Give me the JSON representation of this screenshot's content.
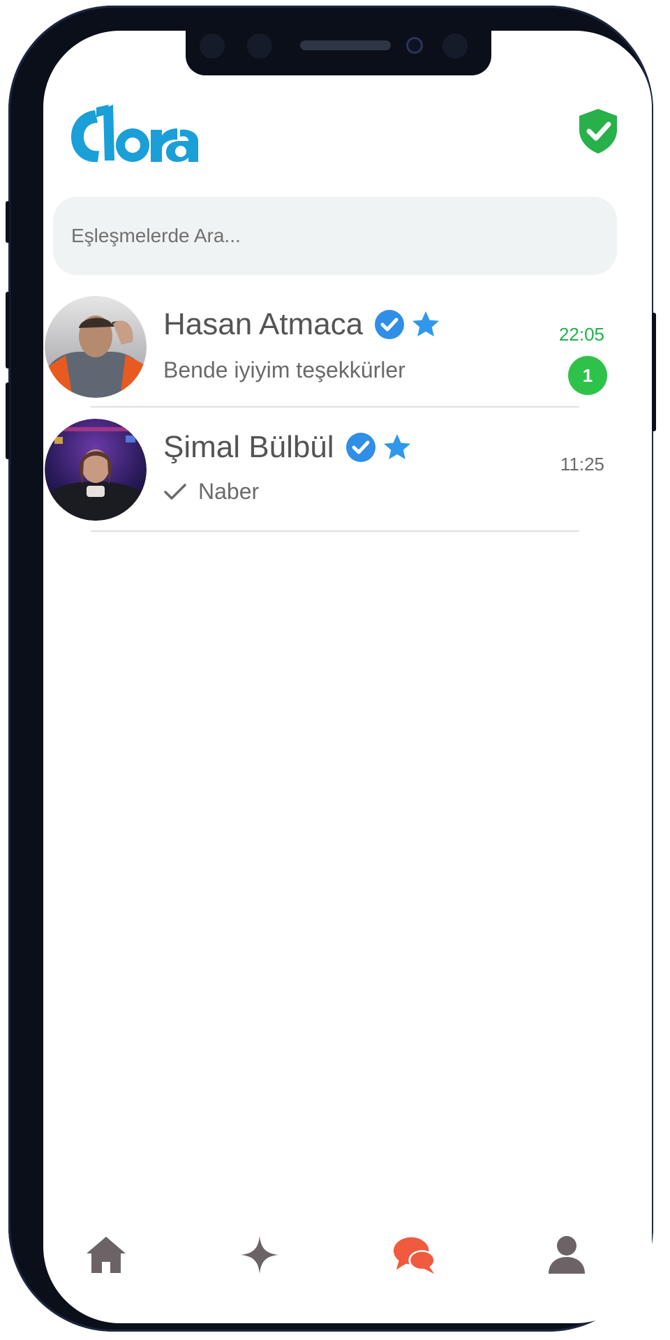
{
  "app": {
    "logo_text": "dora",
    "brand_color": "#1a9fd8",
    "shield_color": "#28b04a"
  },
  "search": {
    "placeholder": "Eşleşmelerde Ara..."
  },
  "conversations": [
    {
      "name": "Hasan Atmaca",
      "last_message": "Bende iyiyim teşekkürler",
      "time": "22:05",
      "unread_count": "1",
      "verified": true,
      "starred": true
    },
    {
      "name": "Şimal Bülbül",
      "last_message": "Naber",
      "time": "11:25",
      "sent_status": "check-icon",
      "verified": true,
      "starred": true
    }
  ],
  "tabbar": {
    "items": [
      "home-icon",
      "sparkle-icon",
      "chat-icon",
      "profile-icon"
    ],
    "active": "chat-icon",
    "active_color": "#f05a3e",
    "inactive_color": "#6b6365"
  }
}
